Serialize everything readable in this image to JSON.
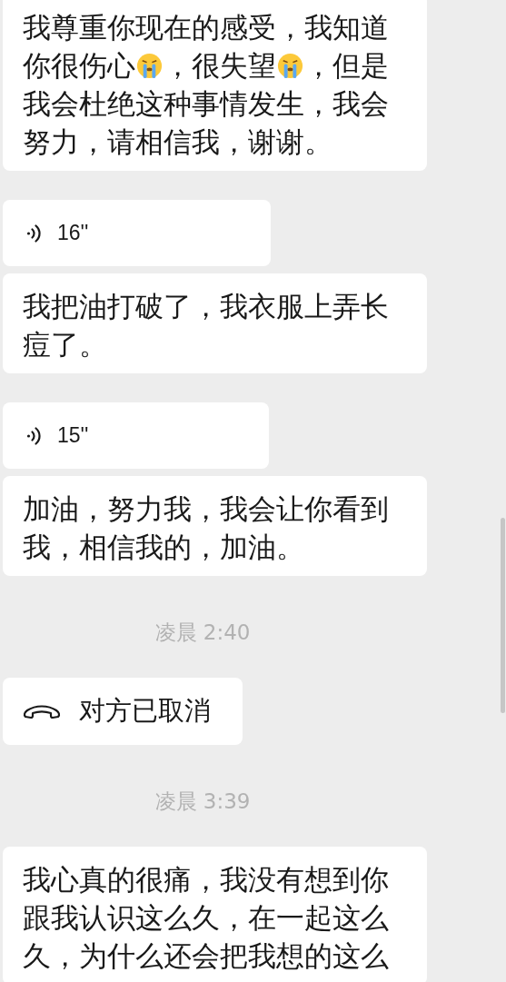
{
  "messages": [
    {
      "kind": "text",
      "segments": [
        {
          "kind": "text",
          "text": "我尊重你现在的感受，我知道你很伤心"
        },
        {
          "kind": "emoji"
        },
        {
          "kind": "text",
          "text": "，很失望"
        },
        {
          "kind": "emoji"
        },
        {
          "kind": "text",
          "text": "，但是我会杜绝这种事情发生，我会努力，请相信我，谢谢。"
        }
      ]
    },
    {
      "kind": "voice",
      "duration": "16''",
      "transcript": "我把油打破了，我衣服上弄长痘了。"
    },
    {
      "kind": "voice",
      "duration": "15''",
      "transcript": "加油，努力我，我会让你看到我，相信我的，加油。"
    },
    {
      "kind": "time",
      "text": "凌晨 2:40"
    },
    {
      "kind": "call",
      "text": "对方已取消"
    },
    {
      "kind": "time",
      "text": "凌晨 3:39"
    },
    {
      "kind": "text",
      "segments": [
        {
          "kind": "text",
          "text": "我心真的很痛，我没有想到你跟我认识这么久，在一起这么久，为什么还会把我想的这么"
        }
      ]
    }
  ]
}
